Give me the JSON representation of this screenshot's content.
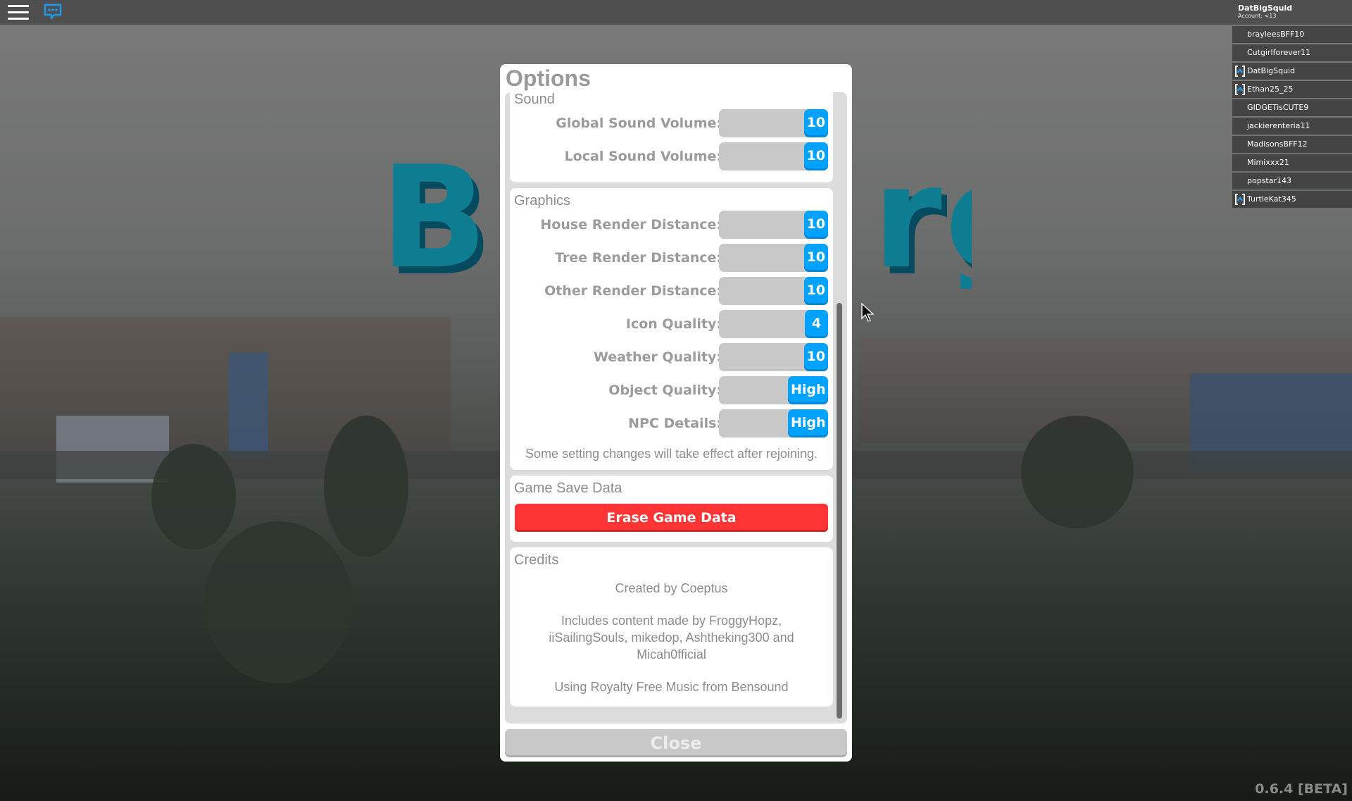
{
  "topbar": {
    "menu_icon": "hamburger-menu-icon",
    "chat_icon": "chat-bubble-icon"
  },
  "player_list": {
    "local_player": "DatBigSquid",
    "account_label": "Account: <13",
    "players": [
      {
        "name": "brayleesBFF10",
        "premium": false
      },
      {
        "name": "Cutgirlforever11",
        "premium": false
      },
      {
        "name": "DatBigSquid",
        "premium": true
      },
      {
        "name": "Ethan25_25",
        "premium": true
      },
      {
        "name": "GIDGETisCUTE9",
        "premium": false
      },
      {
        "name": "jackierenteria11",
        "premium": false
      },
      {
        "name": "MadisonsBFF12",
        "premium": false
      },
      {
        "name": "Mimixxx21",
        "premium": false
      },
      {
        "name": "popstar143",
        "premium": false
      },
      {
        "name": "TurtleKat345",
        "premium": true
      }
    ]
  },
  "background": {
    "logo_left": "Bl",
    "logo_right": "rg"
  },
  "options": {
    "title": "Options",
    "sound": {
      "title": "Sound",
      "settings": [
        {
          "label": "Global Sound Volume:",
          "value": "10"
        },
        {
          "label": "Local Sound Volume:",
          "value": "10"
        }
      ]
    },
    "graphics": {
      "title": "Graphics",
      "settings": [
        {
          "label": "House Render Distance:",
          "value": "10"
        },
        {
          "label": "Tree Render Distance:",
          "value": "10"
        },
        {
          "label": "Other Render Distance:",
          "value": "10"
        },
        {
          "label": "Icon Quality:",
          "value": "4"
        },
        {
          "label": "Weather Quality:",
          "value": "10"
        },
        {
          "label": "Object Quality:",
          "value": "High"
        },
        {
          "label": "NPC Details:",
          "value": "High"
        }
      ],
      "note": "Some setting changes will take effect after rejoining."
    },
    "game_save": {
      "title": "Game Save Data",
      "erase_label": "Erase Game Data"
    },
    "credits": {
      "title": "Credits",
      "lines": [
        "Created by Coeptus",
        "Includes content made by FroggyHopz, iiSailingSouls, mikedop, Ashtheking300 and Micah0fficial",
        "Using Royalty Free Music from Bensound"
      ]
    },
    "close_label": "Close"
  },
  "version": "0.6.4 [BETA]",
  "colors": {
    "accent_blue": "#00a2ff",
    "erase_red": "#ff3535",
    "label_gray": "#9b9b9b"
  }
}
